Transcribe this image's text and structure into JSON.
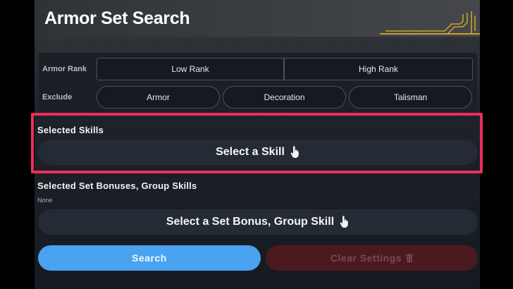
{
  "header": {
    "title": "Armor Set Search"
  },
  "filters": {
    "armor_rank": {
      "label": "Armor Rank",
      "options": [
        "Low Rank",
        "High Rank"
      ]
    },
    "exclude": {
      "label": "Exclude",
      "options": [
        "Armor",
        "Decoration",
        "Talisman"
      ]
    }
  },
  "selected_skills": {
    "title": "Selected Skills",
    "button_label": "Select a Skill",
    "button_icon": "pointer-hand-icon"
  },
  "set_bonuses": {
    "title": "Selected Set Bonuses, Group Skills",
    "current": "None",
    "button_label": "Select a Set Bonus, Group Skill",
    "button_icon": "pointer-hand-icon"
  },
  "actions": {
    "search_label": "Search",
    "clear_label": "Clear Settings",
    "clear_icon": "trash-icon"
  },
  "colors": {
    "highlight": "#ef2d5e",
    "search_button": "#4aa3f0",
    "clear_button": "#4a1a1f",
    "ornament_gold": "#c9a227"
  }
}
